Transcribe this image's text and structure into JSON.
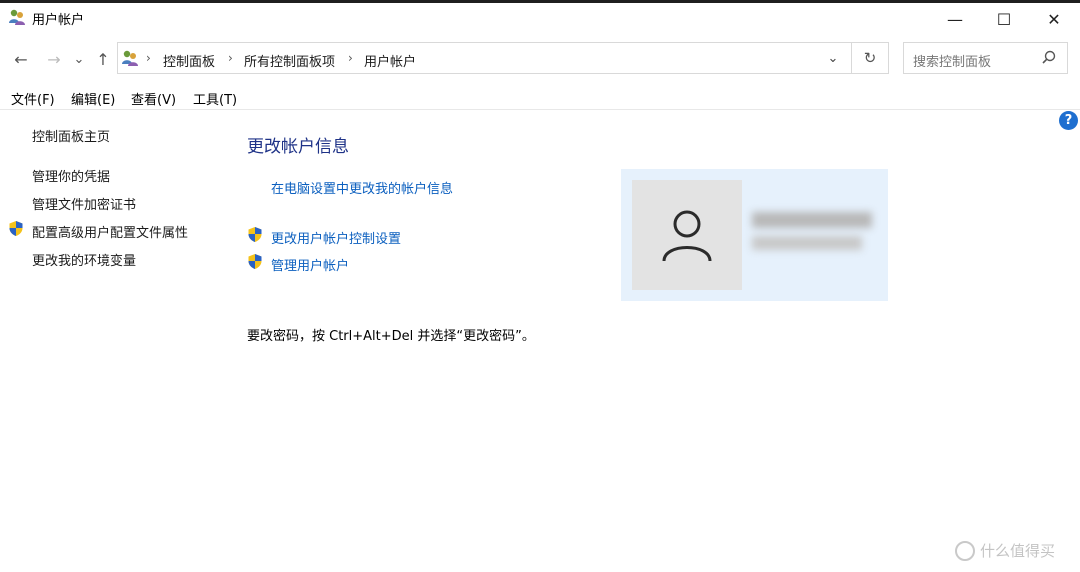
{
  "window": {
    "title": "用户帐户",
    "controls": {
      "minimize": "—",
      "maximize": "☐",
      "close": "✕"
    }
  },
  "nav": {
    "back": "←",
    "forward": "→",
    "recent": "⌄",
    "up": "↑"
  },
  "address": {
    "breadcrumbs": [
      "控制面板",
      "所有控制面板项",
      "用户帐户"
    ],
    "separator": "›",
    "dropdown": "⌄",
    "refresh": "↻"
  },
  "search": {
    "placeholder": "搜索控制面板"
  },
  "menu": [
    {
      "label": "文件(F)"
    },
    {
      "label": "编辑(E)"
    },
    {
      "label": "查看(V)"
    },
    {
      "label": "工具(T)"
    }
  ],
  "left_pane": {
    "home": "控制面板主页",
    "links": [
      "管理你的凭据",
      "管理文件加密证书",
      "配置高级用户配置文件属性",
      "更改我的环境变量"
    ]
  },
  "main": {
    "heading": "更改帐户信息",
    "pc_settings_link": "在电脑设置中更改我的帐户信息",
    "uac_link": "更改用户帐户控制设置",
    "manage_link": "管理用户帐户",
    "password_note": "要改密码，按 Ctrl+Alt+Del 并选择“更改密码”。"
  },
  "help": "?",
  "watermark": "什么值得买",
  "colors": {
    "heading": "#1e3287",
    "link": "#0b5fbf",
    "card": "#e6f1fc"
  }
}
